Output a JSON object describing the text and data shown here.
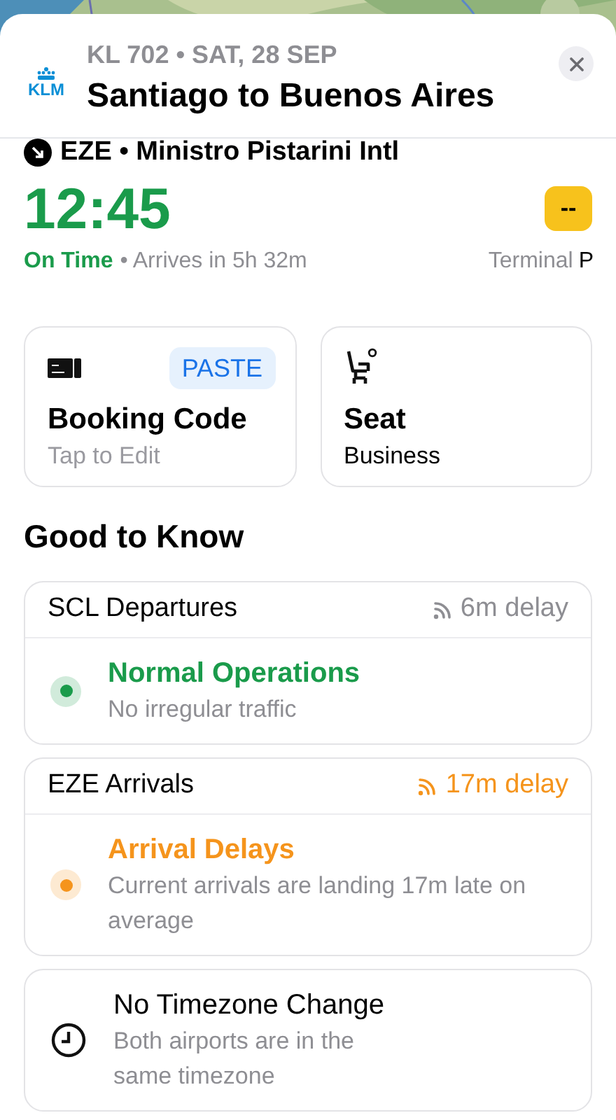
{
  "header": {
    "logo": "KLM",
    "subtitle": "KL 702 • SAT, 28 SEP",
    "title": "Santiago to Buenos Aires"
  },
  "arrival": {
    "airport": "EZE • Ministro Pistarini Intl",
    "time": "12:45",
    "on_time": true,
    "status": "On Time",
    "eta": "• Arrives in 5h 32m",
    "gate": "--",
    "terminal_label": "Terminal",
    "terminal": "P"
  },
  "cards": [
    {
      "kind": "booking",
      "title": "Booking Code",
      "subtitle": "Tap to Edit",
      "action": "PASTE"
    },
    {
      "kind": "seat",
      "title": "Seat",
      "subtitle": "Business"
    }
  ],
  "section_title": "Good to Know",
  "items": [
    {
      "kind": "status",
      "header": "SCL Departures",
      "delay": "6m delay",
      "delay_alert": false,
      "title": "Normal Operations",
      "text": "No irregular traffic",
      "color": "#1a9b4b"
    },
    {
      "kind": "status",
      "header": "EZE Arrivals",
      "delay": "17m delay",
      "delay_alert": true,
      "title": "Arrival Delays",
      "text": "Current arrivals are landing 17m late on average",
      "color": "#f5941c"
    },
    {
      "kind": "info",
      "title": "No Timezone Change",
      "text": "Both airports are in the same timezone"
    }
  ]
}
